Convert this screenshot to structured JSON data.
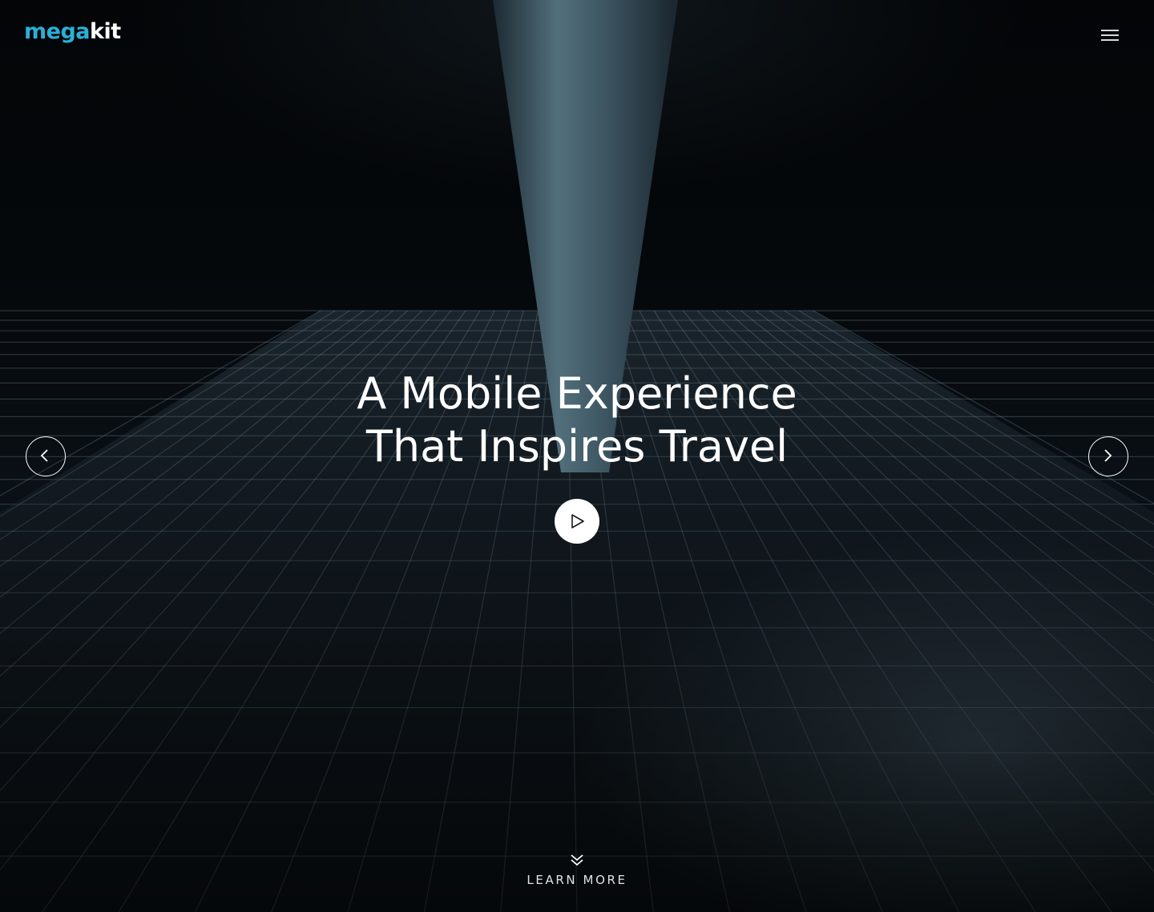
{
  "header": {
    "logo_part1": "mega",
    "logo_part2": "kit",
    "menu_icon": "hamburger-menu-icon"
  },
  "hero": {
    "headline_line1": "A Mobile Experience",
    "headline_line2": "That Inspires Travel",
    "play_icon": "play-icon",
    "prev_icon": "chevron-left-icon",
    "next_icon": "chevron-right-icon"
  },
  "footer": {
    "learn_more_label": "LEARN MORE",
    "learn_more_icon": "double-chevron-down-icon"
  },
  "colors": {
    "brand_accent": "#2ab0d8",
    "text_primary": "#ffffff",
    "background": "#05080b"
  }
}
